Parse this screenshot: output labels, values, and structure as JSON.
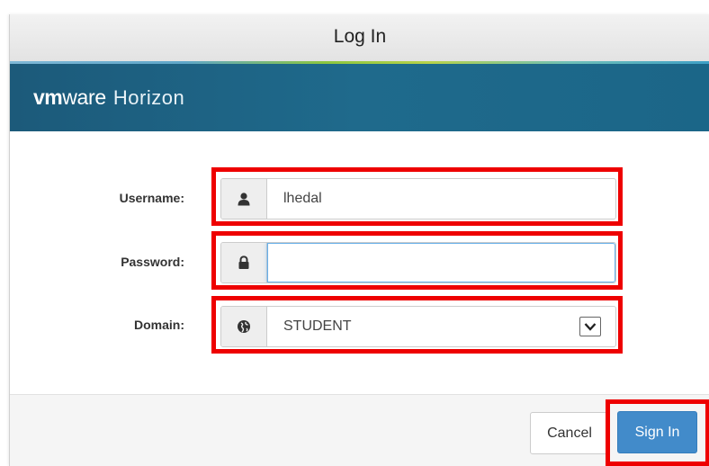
{
  "dialog": {
    "title": "Log In"
  },
  "banner": {
    "brand_vm": "vm",
    "brand_ware": "ware",
    "product": "Horizon"
  },
  "form": {
    "username_label": "Username:",
    "username_value": "lhedal",
    "username_icon": "user-icon",
    "password_label": "Password:",
    "password_value": "",
    "password_icon": "lock-icon",
    "domain_label": "Domain:",
    "domain_value": "STUDENT",
    "domain_icon": "globe-icon"
  },
  "buttons": {
    "cancel": "Cancel",
    "sign_in": "Sign In"
  },
  "colors": {
    "banner": "#1f6a8c",
    "primary_button": "#428bca",
    "highlight": "#ee0000"
  }
}
